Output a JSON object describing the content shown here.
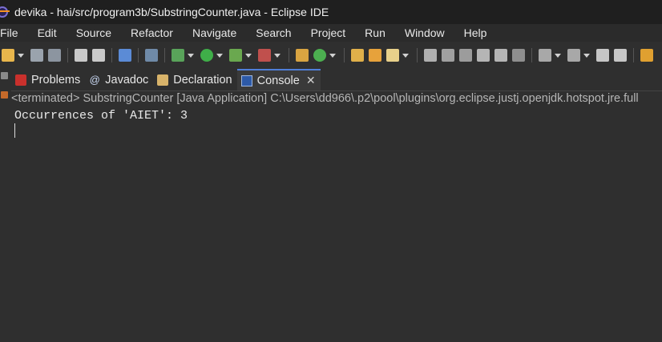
{
  "window": {
    "title": "devika - hai/src/program3b/SubstringCounter.java - Eclipse IDE"
  },
  "menu": [
    "File",
    "Edit",
    "Source",
    "Refactor",
    "Navigate",
    "Search",
    "Project",
    "Run",
    "Window",
    "Help"
  ],
  "tabs": [
    {
      "label": "Problems",
      "icon": "problems-icon",
      "active": false
    },
    {
      "label": "Javadoc",
      "icon": "javadoc-icon",
      "active": false
    },
    {
      "label": "Declaration",
      "icon": "declaration-icon",
      "active": false
    },
    {
      "label": "Console",
      "icon": "console-icon",
      "active": true
    }
  ],
  "console": {
    "header": "<terminated> SubstringCounter [Java Application] C:\\Users\\dd966\\.p2\\pool\\plugins\\org.eclipse.justj.openjdk.hotspot.jre.full",
    "output": "Occurrences of 'AIET': 3"
  },
  "colors": {
    "background": "#2f2f2f",
    "titlebar": "#1f1f1f",
    "active_tab_accent": "#4f7fd9"
  }
}
